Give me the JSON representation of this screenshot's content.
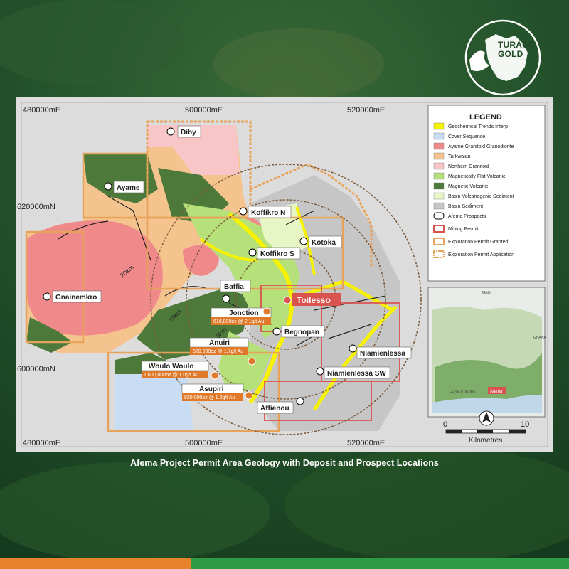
{
  "brand": {
    "name_line1": "TURACO",
    "name_line2": "GOLD"
  },
  "caption": "Afema Project Permit Area Geology with Deposit and Prospect Locations",
  "colors": {
    "background": "#1f4a26",
    "accent_orange": "#e8822c",
    "accent_green": "#2e9a45",
    "deposit_label": "#e07a2a"
  },
  "map": {
    "grid_labels": {
      "top_x": [
        "480000mE",
        "500000mE",
        "520000mE"
      ],
      "bottom_x": [
        "480000mE",
        "500000mE",
        "520000mE"
      ],
      "left_y": [
        "620000mN",
        "600000mN"
      ]
    },
    "radius_labels": [
      "20km",
      "10km",
      "5km"
    ],
    "headline_deposit": "Toilesso",
    "prospects": [
      "Diby",
      "Ayame",
      "Koffikro N",
      "Kotoka",
      "Koffikro S",
      "Gnainemkro",
      "Baffia",
      "Begnopan",
      "Niamienlessa",
      "Niamienlessa SW",
      "Affienou"
    ],
    "deposits": [
      {
        "name": "Jonction",
        "resource": "610,000oz @ 2.1g/t Au"
      },
      {
        "name": "Anuiri",
        "resource": "520,000oz @ 1.7g/t Au"
      },
      {
        "name": "Woulo Woulo",
        "resource": "1,600,000oz @ 1.0g/t Au"
      },
      {
        "name": "Asupiri",
        "resource": "820,000oz @ 1.2g/t Au"
      }
    ],
    "scale": {
      "start": "0",
      "end": "10",
      "unit": "Kilometres"
    },
    "inset_labels": [
      "MALI",
      "GHANA",
      "COTE D'IVOIRE",
      "Afema"
    ]
  },
  "legend": {
    "title": "LEGEND",
    "items": [
      {
        "label": "Geochemical Trends Interp",
        "color": "#f7f200"
      },
      {
        "label": "Cover Sequence",
        "color": "#c8dcf3"
      },
      {
        "label": "Ayame Granitoid Granodiorite",
        "color": "#f08a8a"
      },
      {
        "label": "Tarkwaian",
        "color": "#f5c48e"
      },
      {
        "label": "Northern Granitoid",
        "color": "#f8c6c6"
      },
      {
        "label": "Magnetically Flat Volcanic",
        "color": "#b6e07a"
      },
      {
        "label": "Magnetic Volcanic",
        "color": "#4d7a3a"
      },
      {
        "label": "Basin Volcanogenic Sediment",
        "color": "#e8f6c6"
      },
      {
        "label": "Basin Sediment",
        "color": "#c6c6c6"
      },
      {
        "label": "Afema Prospects",
        "color": "#ffffff"
      },
      {
        "label": "Mining Permit",
        "color": "#d9534f"
      },
      {
        "label": "Exploration Permit Granted",
        "color": "#e8a35a"
      },
      {
        "label": "Exploration Permit Application",
        "color": "#e8a35a"
      }
    ]
  }
}
